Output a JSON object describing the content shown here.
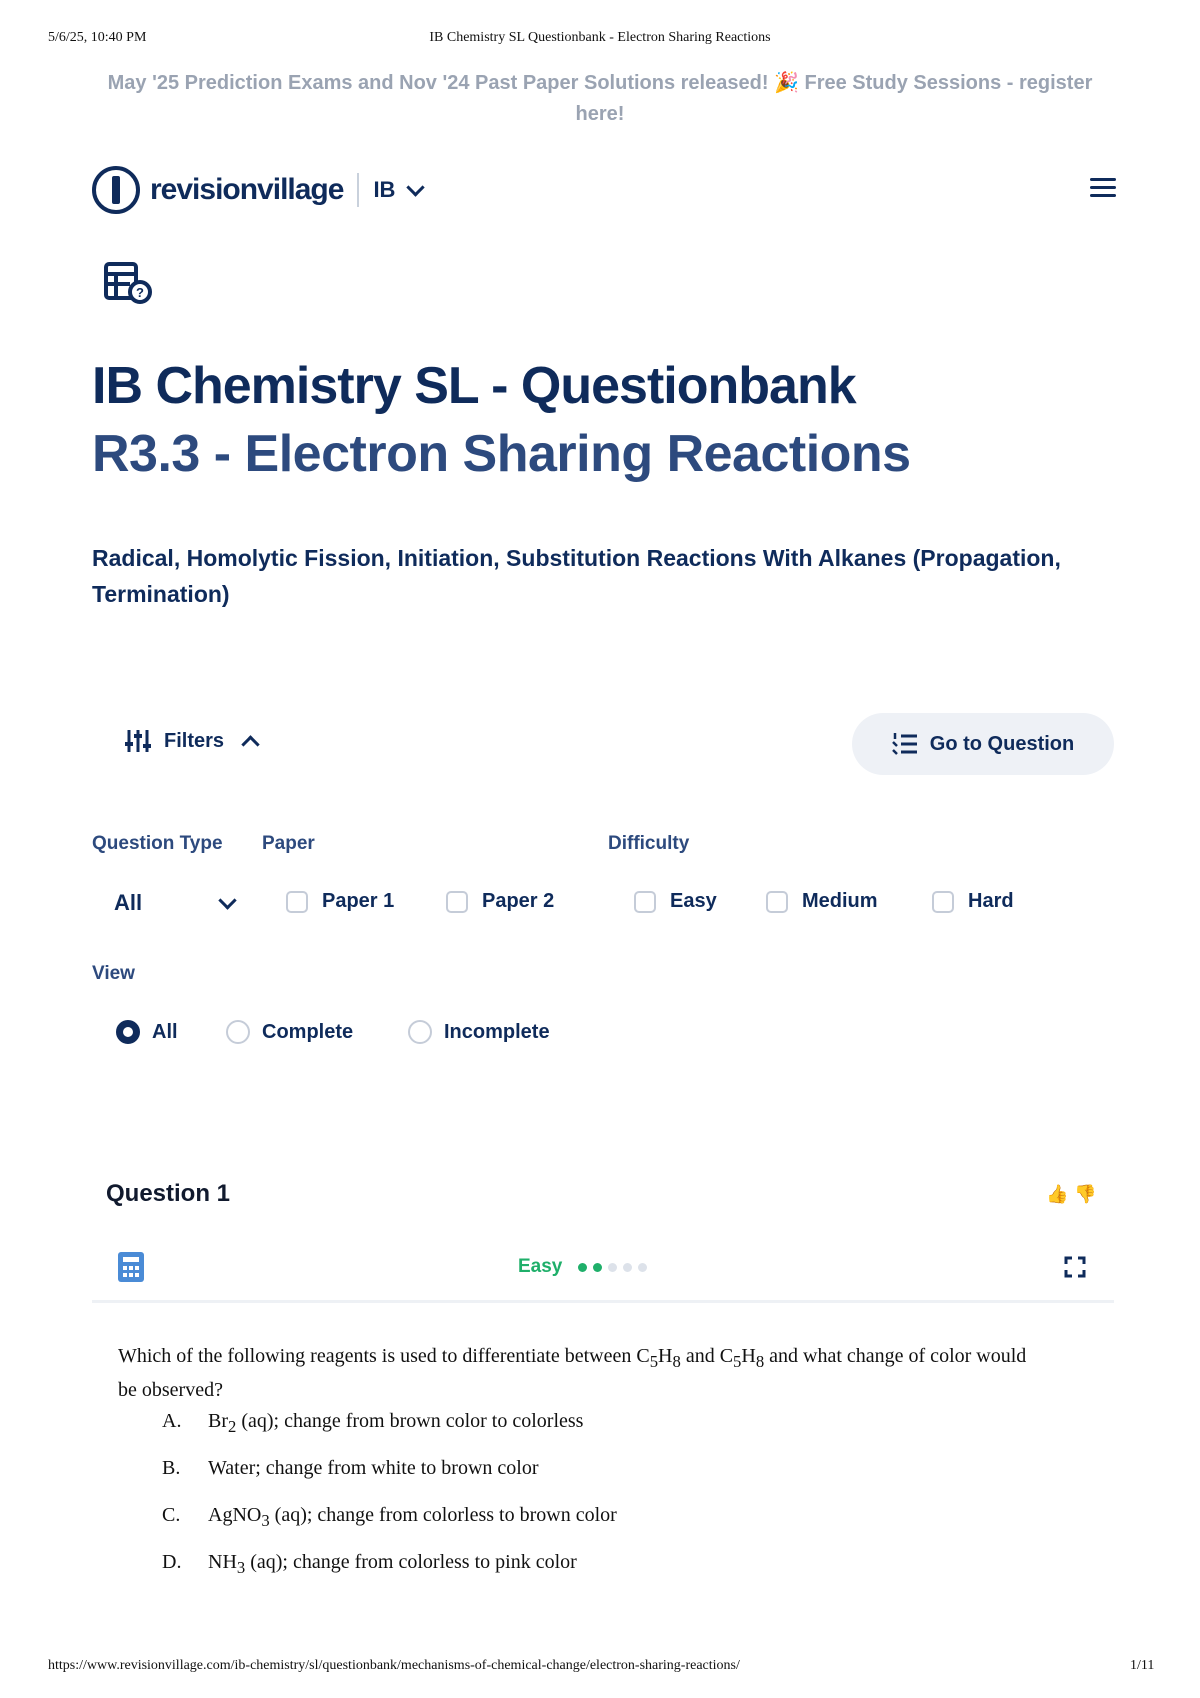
{
  "print_header": {
    "date": "5/6/25, 10:40 PM",
    "title": "IB Chemistry SL Questionbank - Electron Sharing Reactions"
  },
  "banner": {
    "text": "May '25 Prediction Exams and Nov '24 Past Paper Solutions released! 🎉 Free Study Sessions - register here!"
  },
  "nav": {
    "logo_text": "revisionvillage",
    "curriculum": "IB"
  },
  "page": {
    "title": "IB Chemistry SL - Questionbank",
    "topic": "R3.3 - Electron Sharing Reactions",
    "subtopic": "Radical, Homolytic Fission, Initiation, Substitution Reactions With Alkanes (Propagation, Termination)"
  },
  "filters": {
    "toggle_label": "Filters",
    "goto_label": "Go to Question",
    "question_type": {
      "label": "Question Type",
      "value": "All"
    },
    "paper": {
      "label": "Paper",
      "options": [
        "Paper 1",
        "Paper 2"
      ]
    },
    "difficulty": {
      "label": "Difficulty",
      "options": [
        "Easy",
        "Medium",
        "Hard"
      ]
    },
    "view": {
      "label": "View",
      "options": [
        "All",
        "Complete",
        "Incomplete"
      ],
      "selected": "All"
    }
  },
  "question": {
    "title": "Question 1",
    "difficulty_label": "Easy",
    "difficulty_level": 2,
    "difficulty_max": 5,
    "prompt_html": "Which of the following reagents is used to differentiate between C<sub>5</sub>H<sub>8</sub> and C<sub>5</sub>H<sub>8</sub> and what change of color would be observed?",
    "options": [
      {
        "key": "A.",
        "html": "Br<sub>2</sub> (aq); change from brown color to colorless"
      },
      {
        "key": "B.",
        "html": "Water; change from white to brown color"
      },
      {
        "key": "C.",
        "html": "AgNO<sub>3</sub> (aq); change from colorless to brown color"
      },
      {
        "key": "D.",
        "html": "NH<sub>3</sub> (aq); change from colorless to pink color"
      }
    ]
  },
  "print_footer": {
    "url": "https://www.revisionvillage.com/ib-chemistry/sl/questionbank/mechanisms-of-chemical-change/electron-sharing-reactions/",
    "page": "1/11"
  },
  "colors": {
    "primary": "#0f2b5b",
    "secondary": "#2d4a7e",
    "easy": "#1faf6a",
    "muted": "#9aa3b2"
  }
}
